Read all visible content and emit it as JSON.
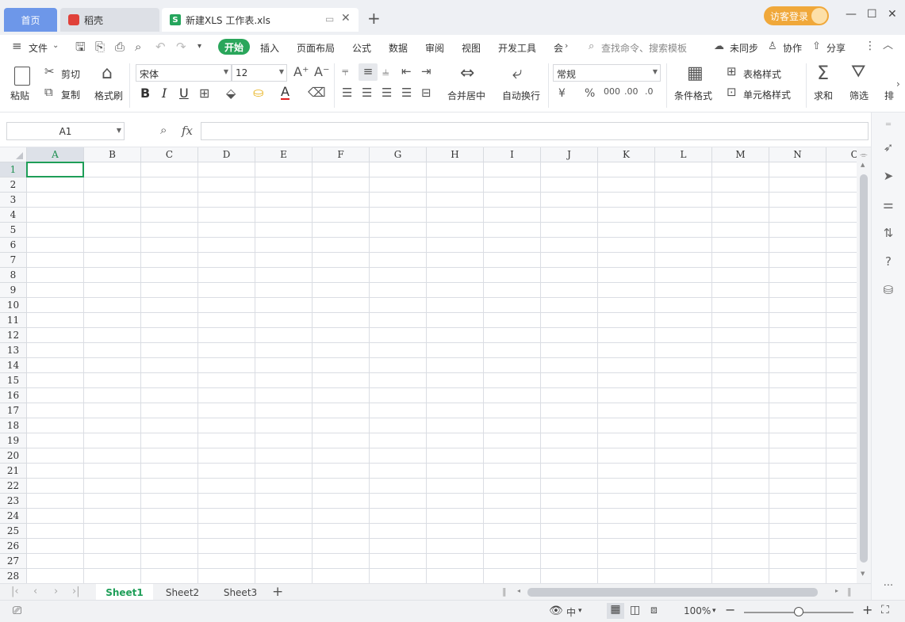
{
  "tabs": {
    "home": "首页",
    "docer": "稻壳",
    "file": "新建XLS 工作表.xls",
    "file_icon": "S"
  },
  "account": {
    "login": "访客登录"
  },
  "menu": {
    "items": [
      "文件",
      "开始",
      "插入",
      "页面布局",
      "公式",
      "数据",
      "审阅",
      "视图",
      "开发工具",
      "会"
    ],
    "search_placeholder": "查找命令、搜索模板",
    "sync": "未同步",
    "collab": "协作",
    "share": "分享"
  },
  "ribbon": {
    "paste": "粘贴",
    "cut": "剪切",
    "copy": "复制",
    "format_painter": "格式刷",
    "font_name": "宋体",
    "font_size": "12",
    "merge_center": "合并居中",
    "wrap_text": "自动换行",
    "number_format": "常规",
    "cond_format": "条件格式",
    "table_style": "表格样式",
    "cell_style": "单元格样式",
    "sum": "求和",
    "filter": "筛选",
    "sort": "排"
  },
  "formula_bar": {
    "name_box": "A1",
    "fx": "fx",
    "value": ""
  },
  "grid": {
    "columns": [
      "A",
      "B",
      "C",
      "D",
      "E",
      "F",
      "G",
      "H",
      "I",
      "J",
      "K",
      "L",
      "M",
      "N",
      "O"
    ],
    "rows": [
      "1",
      "2",
      "3",
      "4",
      "5",
      "6",
      "7",
      "8",
      "9",
      "10",
      "11",
      "12",
      "13",
      "14",
      "15",
      "16",
      "17",
      "18",
      "19",
      "20",
      "21",
      "22",
      "23",
      "24",
      "25",
      "26",
      "27",
      "28"
    ],
    "active_cell": "A1"
  },
  "sheets": {
    "tabs": [
      "Sheet1",
      "Sheet2",
      "Sheet3"
    ],
    "active": "Sheet1"
  },
  "status": {
    "zoom": "100%",
    "input_mode": "中",
    "sidebar_more": "···"
  },
  "colors": {
    "accent": "#1e9e58",
    "home_tab": "#6d97e9",
    "login": "#f0a83a"
  }
}
